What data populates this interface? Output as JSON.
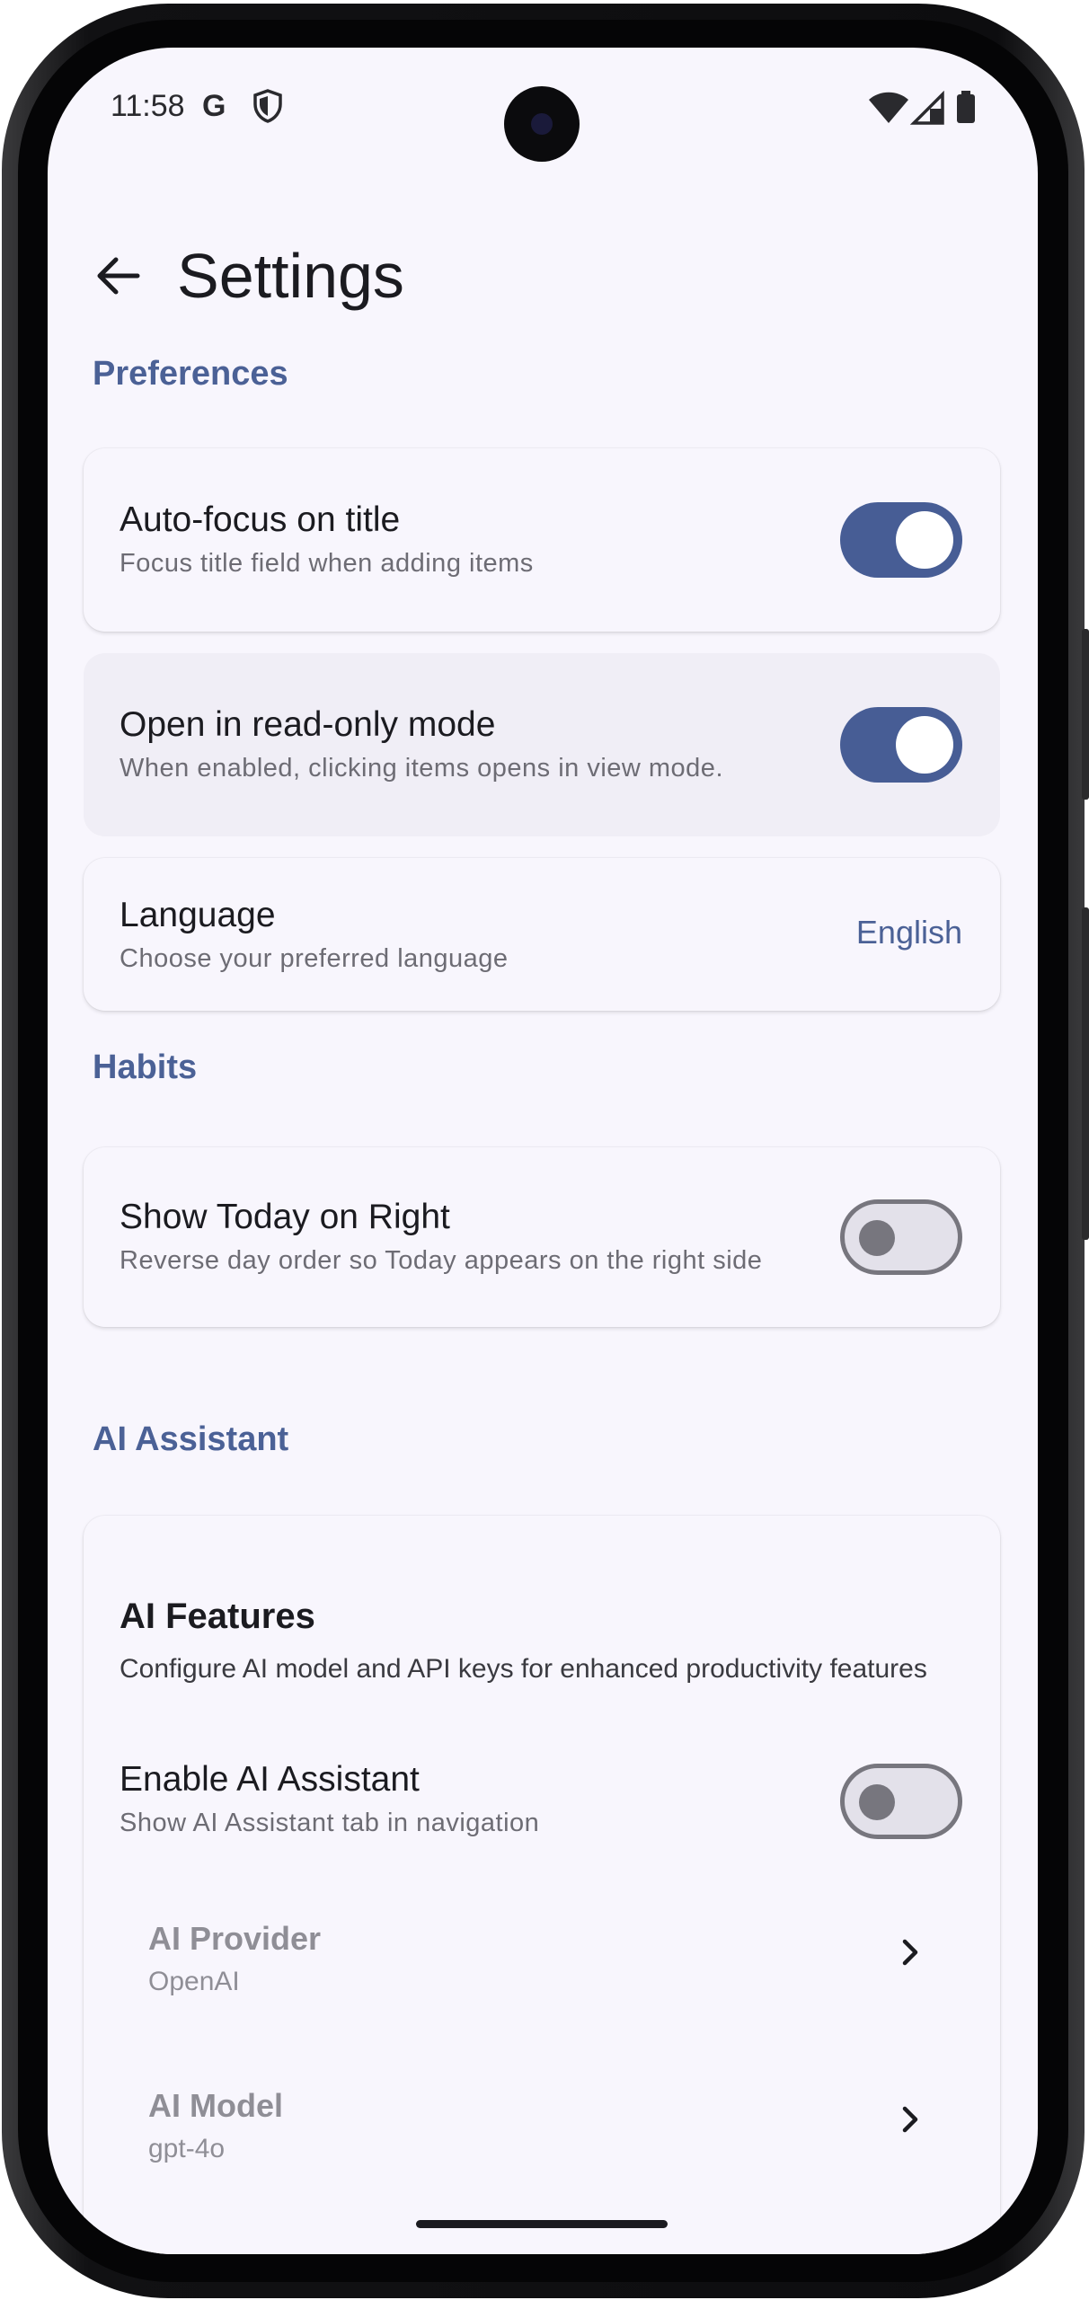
{
  "status_bar": {
    "time": "11:58",
    "google_glyph": "G"
  },
  "header": {
    "title": "Settings"
  },
  "sections": {
    "preferences": "Preferences",
    "habits": "Habits",
    "ai_assistant": "AI Assistant"
  },
  "preferences": {
    "auto_focus": {
      "title": "Auto-focus on title",
      "subtitle": "Focus title field when adding items",
      "enabled": true
    },
    "read_only": {
      "title": "Open in read-only mode",
      "subtitle": "When enabled, clicking items opens in view mode.",
      "enabled": true
    },
    "language": {
      "title": "Language",
      "subtitle": "Choose your preferred language",
      "value": "English"
    }
  },
  "habits": {
    "today_right": {
      "title": "Show Today on Right",
      "subtitle": "Reverse day order so Today appears on the right side",
      "enabled": false
    }
  },
  "ai": {
    "card_title": "AI Features",
    "card_description": "Configure AI model and API keys for enhanced productivity features",
    "enable": {
      "title": "Enable AI Assistant",
      "subtitle": "Show AI Assistant tab in navigation",
      "enabled": false
    },
    "provider": {
      "title": "AI Provider",
      "value": "OpenAI"
    },
    "model": {
      "title": "AI Model",
      "value": "gpt-4o"
    }
  },
  "colors": {
    "accent": "#4b6196",
    "toggle_on": "#475d95",
    "background": "#f8f6fd"
  },
  "icons": [
    "back-arrow-icon",
    "google-icon",
    "shield-icon",
    "wifi-icon",
    "signal-icon",
    "battery-icon",
    "chevron-right-icon"
  ]
}
